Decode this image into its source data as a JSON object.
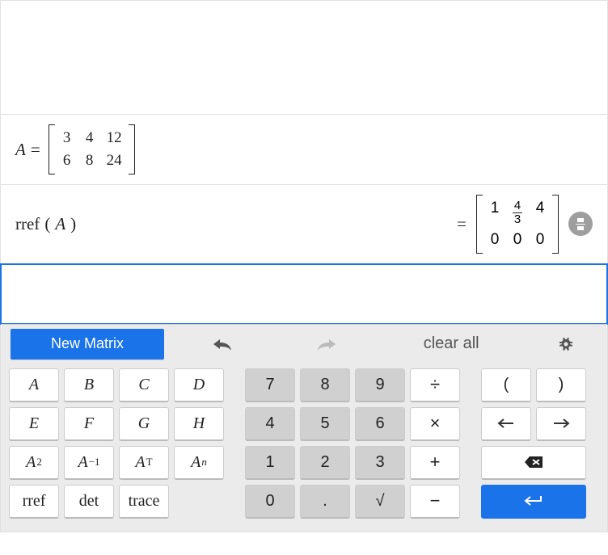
{
  "matrix_def": {
    "name": "A",
    "rows": [
      [
        "3",
        "4",
        "12"
      ],
      [
        "6",
        "8",
        "24"
      ]
    ]
  },
  "expression": {
    "func": "rref",
    "arg": "A"
  },
  "result_matrix": {
    "rows": [
      [
        {
          "v": "1"
        },
        {
          "frac": [
            "4",
            "3"
          ]
        },
        {
          "v": "4"
        }
      ],
      [
        {
          "v": "0"
        },
        {
          "v": "0"
        },
        {
          "v": "0"
        }
      ]
    ]
  },
  "topbar": {
    "new_matrix": "New Matrix",
    "clear_all": "clear all"
  },
  "vars_row1": [
    "A",
    "B",
    "C",
    "D"
  ],
  "vars_row2": [
    "E",
    "F",
    "G",
    "H"
  ],
  "ops_row": [
    {
      "label": "A",
      "sup": "2",
      "name": "square"
    },
    {
      "label": "A",
      "sup": "−1",
      "name": "inverse"
    },
    {
      "label": "A",
      "sup": "T",
      "name": "transpose"
    },
    {
      "label": "A",
      "sup": "n",
      "name": "power",
      "supItalic": true
    }
  ],
  "funcs_row": [
    "rref",
    "det",
    "trace"
  ],
  "nums": {
    "r1": [
      "7",
      "8",
      "9"
    ],
    "r2": [
      "4",
      "5",
      "6"
    ],
    "r3": [
      "1",
      "2",
      "3"
    ],
    "r4": [
      "0",
      "."
    ]
  },
  "ops": {
    "div": "÷",
    "mul": "×",
    "add": "+",
    "sub": "−",
    "sqrt": "√"
  },
  "paren": {
    "l": "(",
    "r": ")"
  },
  "arrows": {
    "left": "←",
    "right": "→",
    "enter": "↵"
  }
}
